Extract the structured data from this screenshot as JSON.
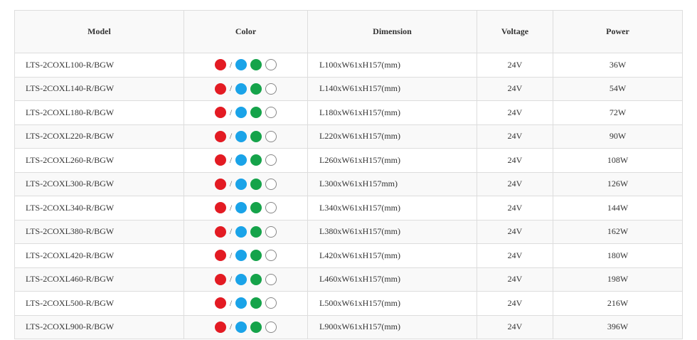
{
  "headers": {
    "model": "Model",
    "color": "Color",
    "dimension": "Dimension",
    "voltage": "Voltage",
    "power": "Power"
  },
  "color_swatches": {
    "red": "#e31b23",
    "blue": "#1aa3e8",
    "green": "#15a34a",
    "white": "#ffffff",
    "separator": "/"
  },
  "rows": [
    {
      "model": "LTS-2COXL100-R/BGW",
      "dimension": "L100xW61xH157(mm)",
      "voltage": "24V",
      "power": "36W"
    },
    {
      "model": "LTS-2COXL140-R/BGW",
      "dimension": "L140xW61xH157(mm)",
      "voltage": "24V",
      "power": "54W"
    },
    {
      "model": "LTS-2COXL180-R/BGW",
      "dimension": "L180xW61xH157(mm)",
      "voltage": "24V",
      "power": "72W"
    },
    {
      "model": "LTS-2COXL220-R/BGW",
      "dimension": "L220xW61xH157(mm)",
      "voltage": "24V",
      "power": "90W"
    },
    {
      "model": "LTS-2COXL260-R/BGW",
      "dimension": "L260xW61xH157(mm)",
      "voltage": "24V",
      "power": "108W"
    },
    {
      "model": "LTS-2COXL300-R/BGW",
      "dimension": "L300xW61xH157mm)",
      "voltage": "24V",
      "power": "126W"
    },
    {
      "model": "LTS-2COXL340-R/BGW",
      "dimension": "L340xW61xH157(mm)",
      "voltage": "24V",
      "power": "144W"
    },
    {
      "model": "LTS-2COXL380-R/BGW",
      "dimension": "L380xW61xH157(mm)",
      "voltage": "24V",
      "power": "162W"
    },
    {
      "model": "LTS-2COXL420-R/BGW",
      "dimension": "L420xW61xH157(mm)",
      "voltage": "24V",
      "power": "180W"
    },
    {
      "model": "LTS-2COXL460-R/BGW",
      "dimension": "L460xW61xH157(mm)",
      "voltage": "24V",
      "power": "198W"
    },
    {
      "model": "LTS-2COXL500-R/BGW",
      "dimension": "L500xW61xH157(mm)",
      "voltage": "24V",
      "power": "216W"
    },
    {
      "model": "LTS-2COXL900-R/BGW",
      "dimension": "L900xW61xH157(mm)",
      "voltage": "24V",
      "power": "396W"
    }
  ]
}
